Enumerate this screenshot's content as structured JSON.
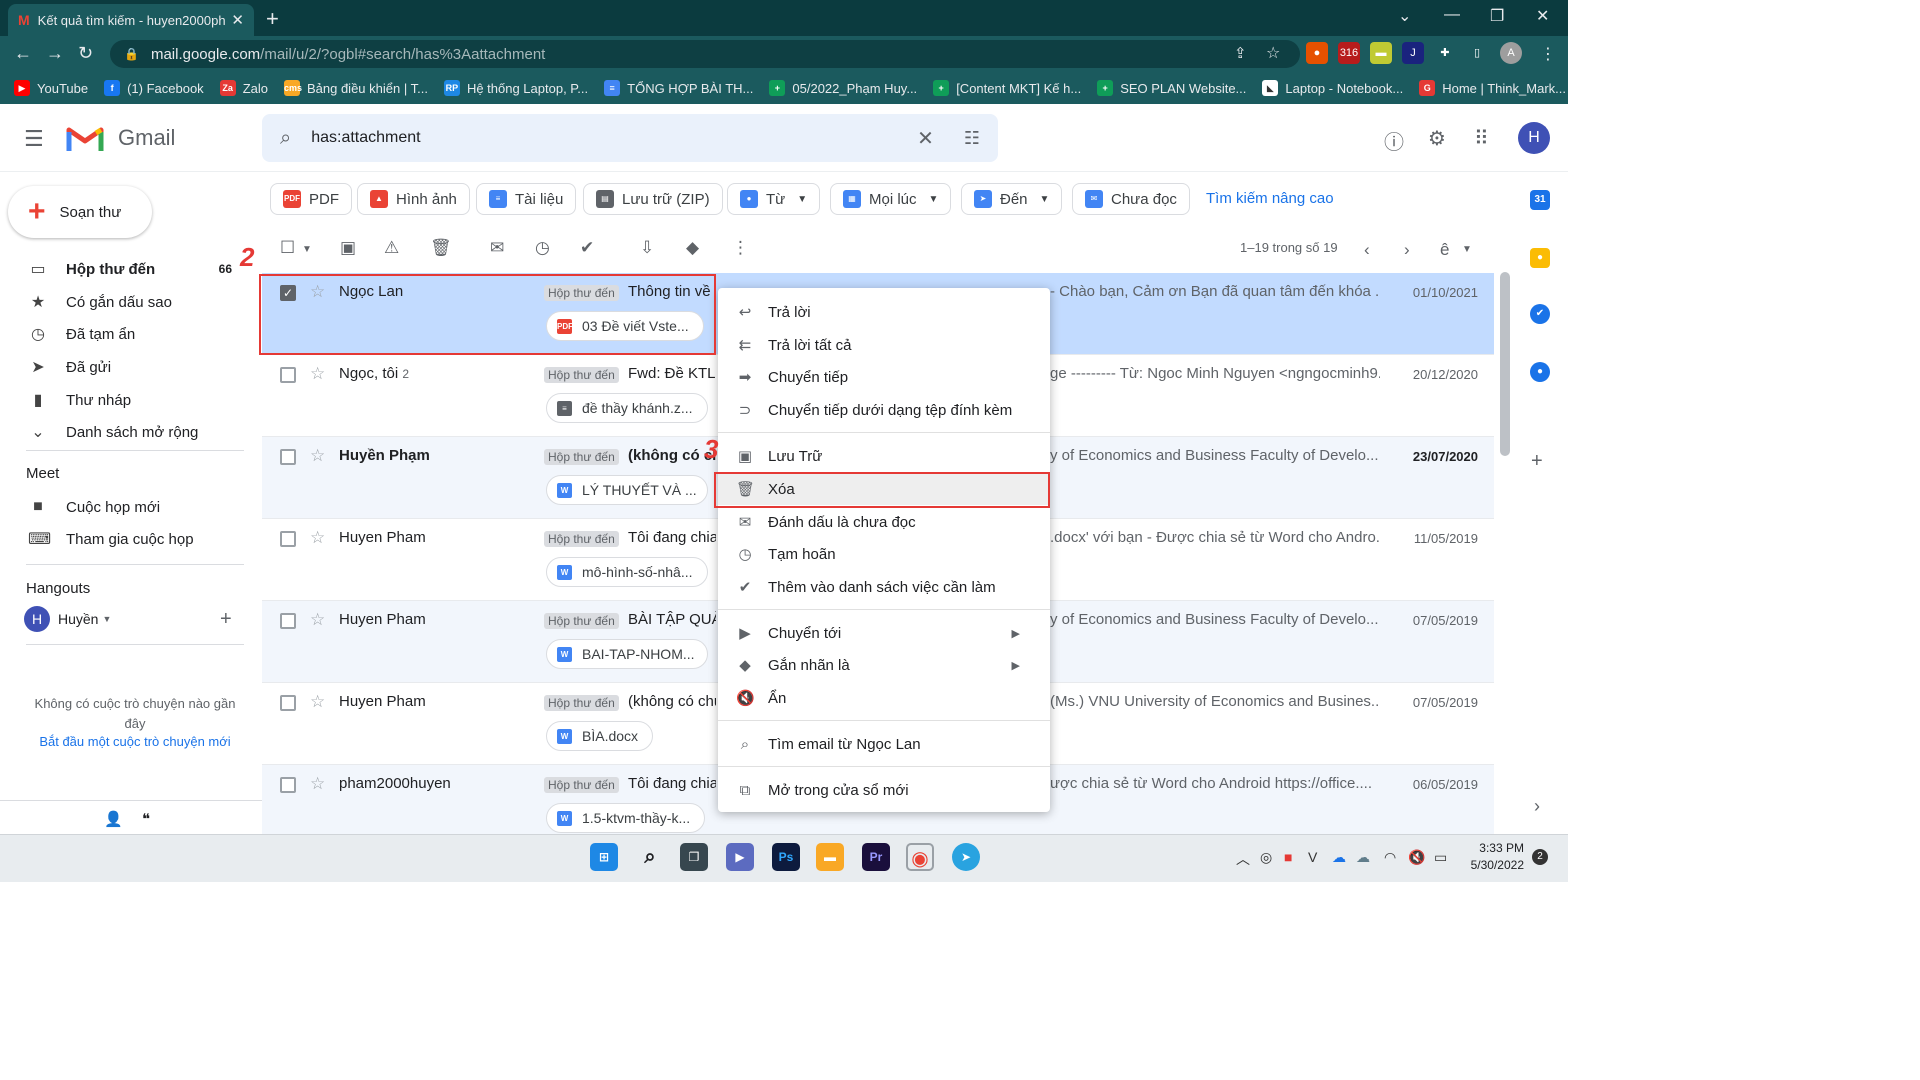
{
  "browser": {
    "tab_title": "Kết quả tìm kiếm - huyen2000ph",
    "url_host": "mail.google.com",
    "url_rest": "/mail/u/2/?ogbl#search/has%3Aattachment",
    "ext_badge": "316"
  },
  "bookmarks": [
    {
      "label": "YouTube",
      "color": "#ff0000",
      "glyph": "▶"
    },
    {
      "label": "(1) Facebook",
      "color": "#1877f2",
      "glyph": "f"
    },
    {
      "label": "Zalo",
      "color": "#e53935",
      "glyph": "Za"
    },
    {
      "label": "Bảng điều khiển | T...",
      "color": "#f9a825",
      "glyph": "cms"
    },
    {
      "label": "Hệ thống Laptop, P...",
      "color": "#1e88e5",
      "glyph": "RP"
    },
    {
      "label": "TỔNG HỢP BÀI TH...",
      "color": "#4285f4",
      "glyph": "≡"
    },
    {
      "label": "05/2022_Phạm Huy...",
      "color": "#0f9d58",
      "glyph": "+"
    },
    {
      "label": "[Content MKT] Kế h...",
      "color": "#0f9d58",
      "glyph": "+"
    },
    {
      "label": "SEO PLAN Website...",
      "color": "#0f9d58",
      "glyph": "+"
    },
    {
      "label": "Laptop - Notebook...",
      "color": "#ffffff",
      "glyph": "◣"
    },
    {
      "label": "Home | Think_Mark...",
      "color": "#e53935",
      "glyph": "G"
    }
  ],
  "gmail": {
    "brand": "Gmail",
    "search_query": "has:attachment",
    "avatar_letter": "H",
    "compose": "Soạn thư",
    "nav": [
      {
        "label": "Hộp thư đến",
        "count": "66",
        "icon": "inbox-icon",
        "glyph": "▭",
        "bold": true
      },
      {
        "label": "Có gắn dấu sao",
        "count": "",
        "icon": "star-icon",
        "glyph": "★",
        "bold": false
      },
      {
        "label": "Đã tạm ẩn",
        "count": "",
        "icon": "clock-icon",
        "glyph": "◷",
        "bold": false
      },
      {
        "label": "Đã gửi",
        "count": "",
        "icon": "send-icon",
        "glyph": "➤",
        "bold": false
      },
      {
        "label": "Thư nháp",
        "count": "",
        "icon": "draft-icon",
        "glyph": "▮",
        "bold": false
      },
      {
        "label": "Danh sách mở rộng",
        "count": "",
        "icon": "chevron-down-icon",
        "glyph": "⌄",
        "bold": false
      }
    ],
    "meet_title": "Meet",
    "meet": [
      {
        "label": "Cuộc họp mới",
        "icon": "video-icon",
        "glyph": "■"
      },
      {
        "label": "Tham gia cuộc họp",
        "icon": "keyboard-icon",
        "glyph": "⌨"
      }
    ],
    "hangouts_title": "Hangouts",
    "hangouts_user": "Huyền",
    "hangouts_empty": "Không có cuộc trò chuyện nào gần đây",
    "hangouts_start": "Bắt đầu một cuộc trò chuyện mới",
    "chips": [
      {
        "label": "PDF",
        "color": "#ea4335",
        "glyph": "PDF",
        "dropdown": false
      },
      {
        "label": "Hình ảnh",
        "color": "#ea4335",
        "glyph": "▲",
        "dropdown": false
      },
      {
        "label": "Tài liệu",
        "color": "#4285f4",
        "glyph": "≡",
        "dropdown": false
      },
      {
        "label": "Lưu trữ (ZIP)",
        "color": "#5f6368",
        "glyph": "▤",
        "dropdown": false
      },
      {
        "label": "Từ",
        "color": "#4285f4",
        "glyph": "●",
        "dropdown": true
      },
      {
        "label": "Mọi lúc",
        "color": "#4285f4",
        "glyph": "▦",
        "dropdown": true
      },
      {
        "label": "Đến",
        "color": "#4285f4",
        "glyph": "➤",
        "dropdown": true
      },
      {
        "label": "Chưa đọc",
        "color": "#4285f4",
        "glyph": "✉",
        "dropdown": false
      }
    ],
    "advanced_search": "Tìm kiếm nâng cao",
    "page_info": "1–19 trong số 19",
    "inbox_label": "Hộp thư đến",
    "emails": [
      {
        "sender": "Ngọc Lan",
        "count": "",
        "subject": "Thông tin về",
        "snippet": "- Chào bạn, Cảm ơn Bạn đã quan tâm đến khóa ...",
        "date": "01/10/2021",
        "attachment": "03 Đề viết Vste...",
        "att_type": "pdf",
        "att_glyph": "PDF",
        "bold": false,
        "selected": true
      },
      {
        "sender": "Ngọc, tôi",
        "count": "2",
        "subject": "Fwd: Đề KTL",
        "snippet": "ge --------- Từ: Ngoc Minh Nguyen <ngngocminh9...",
        "date": "20/12/2020",
        "attachment": "đề thầy khánh.z...",
        "att_type": "gdoc",
        "att_glyph": "≡",
        "bold": false,
        "selected": false
      },
      {
        "sender": "Huyền Phạm",
        "count": "",
        "subject": "(không có ch",
        "snippet": "y of Economics and Business Faculty of Develo...",
        "date": "23/07/2020",
        "attachment": "LÝ THUYẾT VÀ ...",
        "att_type": "doc",
        "att_glyph": "W",
        "bold": true,
        "selected": false
      },
      {
        "sender": "Huyen Pham",
        "count": "",
        "subject": "Tôi đang chia",
        "snippet": ".docx' với bạn - Được chia sẻ từ Word cho Andro...",
        "date": "11/05/2019",
        "attachment": "mô-hình-số-nhâ...",
        "att_type": "doc",
        "att_glyph": "W",
        "bold": false,
        "selected": false
      },
      {
        "sender": "Huyen Pham",
        "count": "",
        "subject": "BÀI TẬP QUẢN",
        "snippet": "y of Economics and Business Faculty of Develo...",
        "date": "07/05/2019",
        "attachment": "BAI-TAP-NHOM...",
        "att_type": "doc",
        "att_glyph": "W",
        "bold": false,
        "selected": false
      },
      {
        "sender": "Huyen Pham",
        "count": "",
        "subject": "(không có chủ",
        "snippet": "(Ms.) VNU University of Economics and Busines...",
        "date": "07/05/2019",
        "attachment": "BÌA.docx",
        "att_type": "doc",
        "att_glyph": "W",
        "bold": false,
        "selected": false
      },
      {
        "sender": "pham2000huyen",
        "count": "",
        "subject": "Tôi đang chia",
        "snippet": "ược chia sẻ từ Word cho Android https://office....",
        "date": "06/05/2019",
        "attachment": "1.5-ktvm-thầy-k...",
        "att_type": "doc",
        "att_glyph": "W",
        "bold": false,
        "selected": false
      }
    ],
    "context_menu": [
      {
        "label": "Trả lời",
        "icon": "reply-icon",
        "glyph": "↩",
        "submenu": false,
        "highlight": false
      },
      {
        "label": "Trả lời tất cả",
        "icon": "reply-all-icon",
        "glyph": "⇇",
        "submenu": false,
        "highlight": false
      },
      {
        "label": "Chuyển tiếp",
        "icon": "forward-icon",
        "glyph": "➡",
        "submenu": false,
        "highlight": false
      },
      {
        "label": "Chuyển tiếp dưới dạng tệp đính kèm",
        "icon": "attachment-icon",
        "glyph": "⊃",
        "submenu": false,
        "highlight": false
      },
      {
        "label": "Lưu Trữ",
        "icon": "archive-icon",
        "glyph": "▣",
        "submenu": false,
        "highlight": false
      },
      {
        "label": "Xóa",
        "icon": "trash-icon",
        "glyph": "🗑",
        "submenu": false,
        "highlight": true
      },
      {
        "label": "Đánh dấu là chưa đọc",
        "icon": "mark-unread-icon",
        "glyph": "✉",
        "submenu": false,
        "highlight": false
      },
      {
        "label": "Tạm hoãn",
        "icon": "snooze-icon",
        "glyph": "◷",
        "submenu": false,
        "highlight": false
      },
      {
        "label": "Thêm vào danh sách việc cần làm",
        "icon": "add-task-icon",
        "glyph": "✔",
        "submenu": false,
        "highlight": false
      },
      {
        "label": "Chuyển tới",
        "icon": "move-to-icon",
        "glyph": "▶",
        "submenu": true,
        "highlight": false
      },
      {
        "label": "Gắn nhãn là",
        "icon": "label-icon",
        "glyph": "◆",
        "submenu": true,
        "highlight": false
      },
      {
        "label": "Ẩn",
        "icon": "mute-icon",
        "glyph": "🔇",
        "submenu": false,
        "highlight": false
      },
      {
        "label": "Tìm email từ Ngọc Lan",
        "icon": "search-icon",
        "glyph": "⌕",
        "submenu": false,
        "highlight": false
      },
      {
        "label": "Mở trong cửa sổ mới",
        "icon": "open-new-window-icon",
        "glyph": "⧉",
        "submenu": false,
        "highlight": false
      }
    ]
  },
  "annotations": {
    "step2": "2",
    "step3": "3"
  },
  "taskbar": {
    "time": "3:33 PM",
    "date": "5/30/2022",
    "notifications": "2"
  }
}
